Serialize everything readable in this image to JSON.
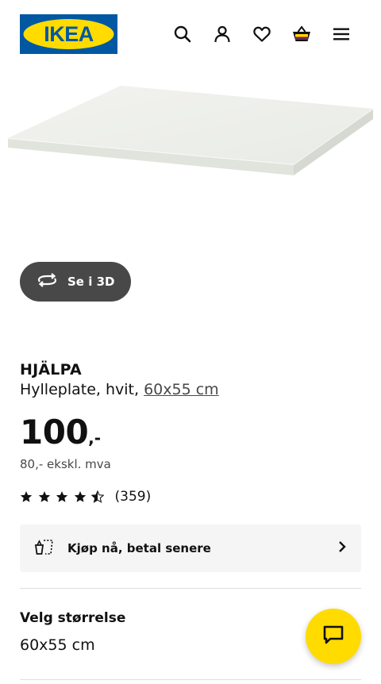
{
  "header": {
    "logo_text": "IKEA",
    "icons": [
      "search-icon",
      "account-icon",
      "heart-icon",
      "cart-icon",
      "menu-icon"
    ]
  },
  "viewer": {
    "button_label": "Se i 3D"
  },
  "product": {
    "name": "HJÄLPA",
    "description": "Hylleplate, hvit, ",
    "size_link": "60x55 cm",
    "price_amount": "100",
    "price_suffix": ",-",
    "price_excl_vat": "80,- ekskl. mva",
    "rating_value": 4.5,
    "rating_max": 5,
    "rating_count": "(359)"
  },
  "paylater": {
    "label": "Kjøp nå, betal senere"
  },
  "size_selector": {
    "heading": "Velg størrelse",
    "value": "60x55 cm"
  },
  "colors": {
    "brand_blue": "#0058A3",
    "brand_yellow": "#FFDB00",
    "button_dark": "#484848",
    "panel_bg": "#F5F5F5"
  }
}
